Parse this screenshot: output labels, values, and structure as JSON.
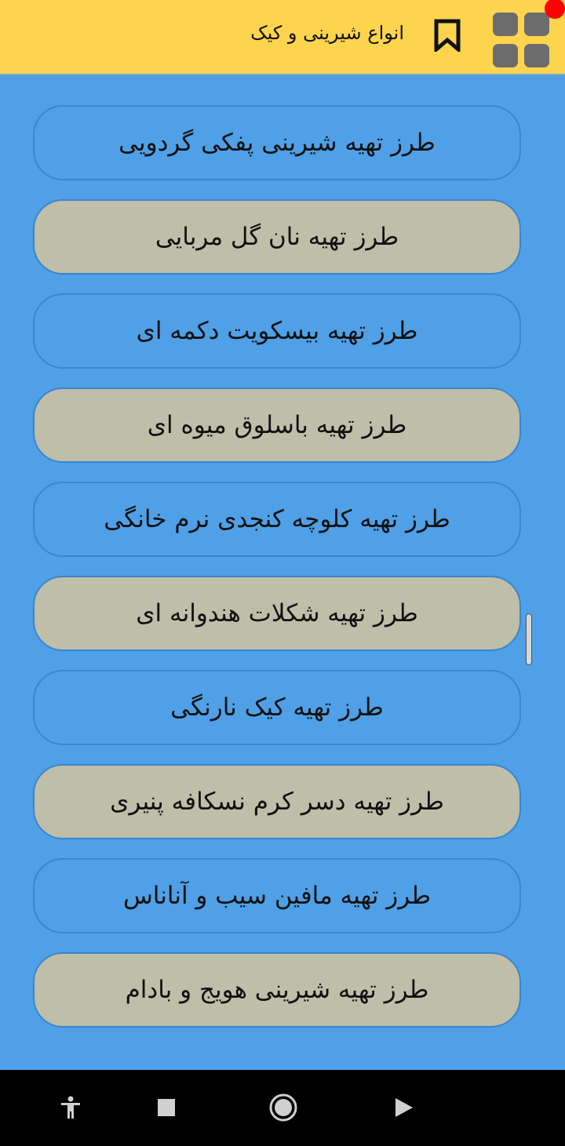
{
  "header": {
    "title": "انواع شیرینی و کیک"
  },
  "list": {
    "items": [
      {
        "label": "طرز تهیه شیرینی پفکی گردویی"
      },
      {
        "label": "طرز تهیه نان گل مربایی"
      },
      {
        "label": "طرز تهیه بیسکویت دکمه ای"
      },
      {
        "label": "طرز تهیه باسلوق میوه ای"
      },
      {
        "label": "طرز تهیه کلوچه کنجدی نرم خانگی"
      },
      {
        "label": "طرز تهیه شکلات هندوانه ای"
      },
      {
        "label": "طرز تهیه کیک نارنگی"
      },
      {
        "label": "طرز تهیه دسر کرم نسکافه پنیری"
      },
      {
        "label": "طرز تهیه مافین سیب و آناناس"
      },
      {
        "label": "طرز تهیه شیرینی هویج و بادام"
      }
    ]
  },
  "icons": {
    "bookmark": "bookmark-icon",
    "menu": "grid-menu-icon",
    "notification": "notification-dot",
    "nav": [
      "accessibility-icon",
      "recents-square-icon",
      "home-circle-icon",
      "back-triangle-icon"
    ]
  },
  "colors": {
    "header_bg": "#fdd44e",
    "page_bg": "#4fa0e6",
    "item_alt_bg": "#bfbea9",
    "notification": "#ff0000"
  }
}
